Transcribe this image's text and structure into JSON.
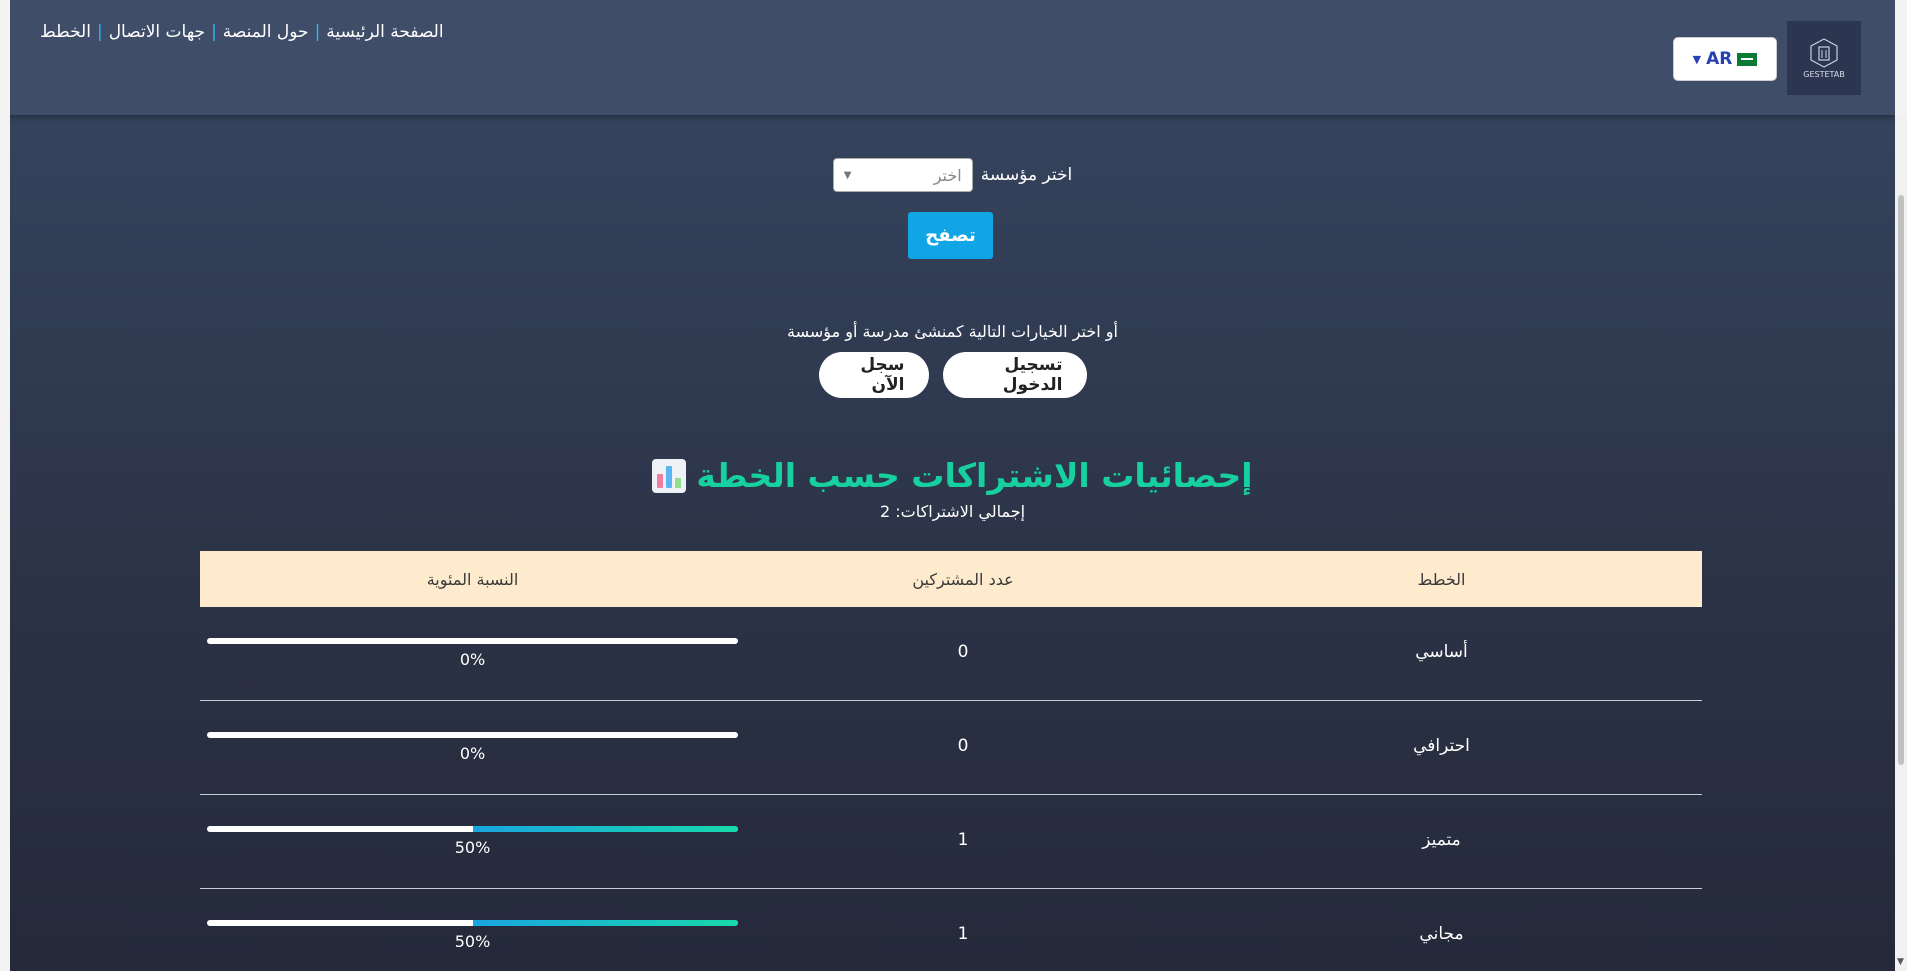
{
  "nav": {
    "home": "الصفحة الرئيسية",
    "about": "حول المنصة",
    "contacts": "جهات الاتصال",
    "plans": "الخطط"
  },
  "language": {
    "code": "AR",
    "flag_icon": "saudi-flag-icon"
  },
  "logo": {
    "text": "GESTETAB"
  },
  "organization": {
    "label": "اختر مؤسسة",
    "placeholder": "اختر",
    "browse_button": "تصفح"
  },
  "auth": {
    "prompt": "أو اختر الخيارات التالية كمنشئ مدرسة أو مؤسسة",
    "login": "تسجيل الدخول",
    "register": "سجل الآن"
  },
  "stats": {
    "title": "إحصائيات الاشتراكات حسب الخطة",
    "total": "إجمالي الاشتراكات: 2",
    "headers": {
      "plan": "الخطط",
      "subscribers": "عدد المشتركين",
      "percentage": "النسبة المئوية"
    },
    "rows": [
      {
        "plan": "أساسي",
        "count": "0",
        "percent": 0,
        "percent_label": "0%"
      },
      {
        "plan": "احترافي",
        "count": "0",
        "percent": 0,
        "percent_label": "0%"
      },
      {
        "plan": "متميز",
        "count": "1",
        "percent": 50,
        "percent_label": "50%"
      },
      {
        "plan": "مجاني",
        "count": "1",
        "percent": 50,
        "percent_label": "50%"
      }
    ]
  },
  "colors": {
    "accent": "#17d0a0",
    "button": "#12a5e6",
    "header_bg": "#feebcd"
  }
}
